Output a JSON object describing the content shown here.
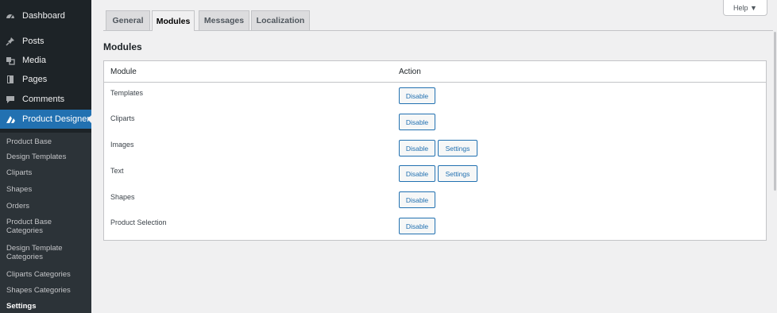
{
  "sidebar": {
    "menu": [
      {
        "label": "Dashboard",
        "icon": "dashboard-icon"
      },
      {
        "label": "Posts",
        "icon": "pin-icon"
      },
      {
        "label": "Media",
        "icon": "media-icon"
      },
      {
        "label": "Pages",
        "icon": "page-icon"
      },
      {
        "label": "Comments",
        "icon": "comment-icon"
      },
      {
        "label": "Product Designer",
        "icon": "product-designer-icon"
      }
    ],
    "submenu": [
      "Product Base",
      "Design Templates",
      "Cliparts",
      "Shapes",
      "Orders",
      "Product Base Categories",
      "Design Template Categories",
      "Cliparts Categories",
      "Shapes Categories",
      "Settings"
    ]
  },
  "help_label": "Help ▼",
  "tabs": [
    "General",
    "Modules",
    "Messages",
    "Localization"
  ],
  "section_title": "Modules",
  "table": {
    "headers": [
      "Module",
      "Action"
    ],
    "rows": [
      {
        "name": "Templates",
        "actions": [
          "Disable"
        ]
      },
      {
        "name": "Cliparts",
        "actions": [
          "Disable"
        ]
      },
      {
        "name": "Images",
        "actions": [
          "Disable",
          "Settings"
        ]
      },
      {
        "name": "Text",
        "actions": [
          "Disable",
          "Settings"
        ]
      },
      {
        "name": "Shapes",
        "actions": [
          "Disable"
        ]
      },
      {
        "name": "Product Selection",
        "actions": [
          "Disable"
        ]
      }
    ]
  },
  "colors": {
    "accent": "#2271b1",
    "sidebar": "#1d2327",
    "submenu": "#2c3338"
  }
}
